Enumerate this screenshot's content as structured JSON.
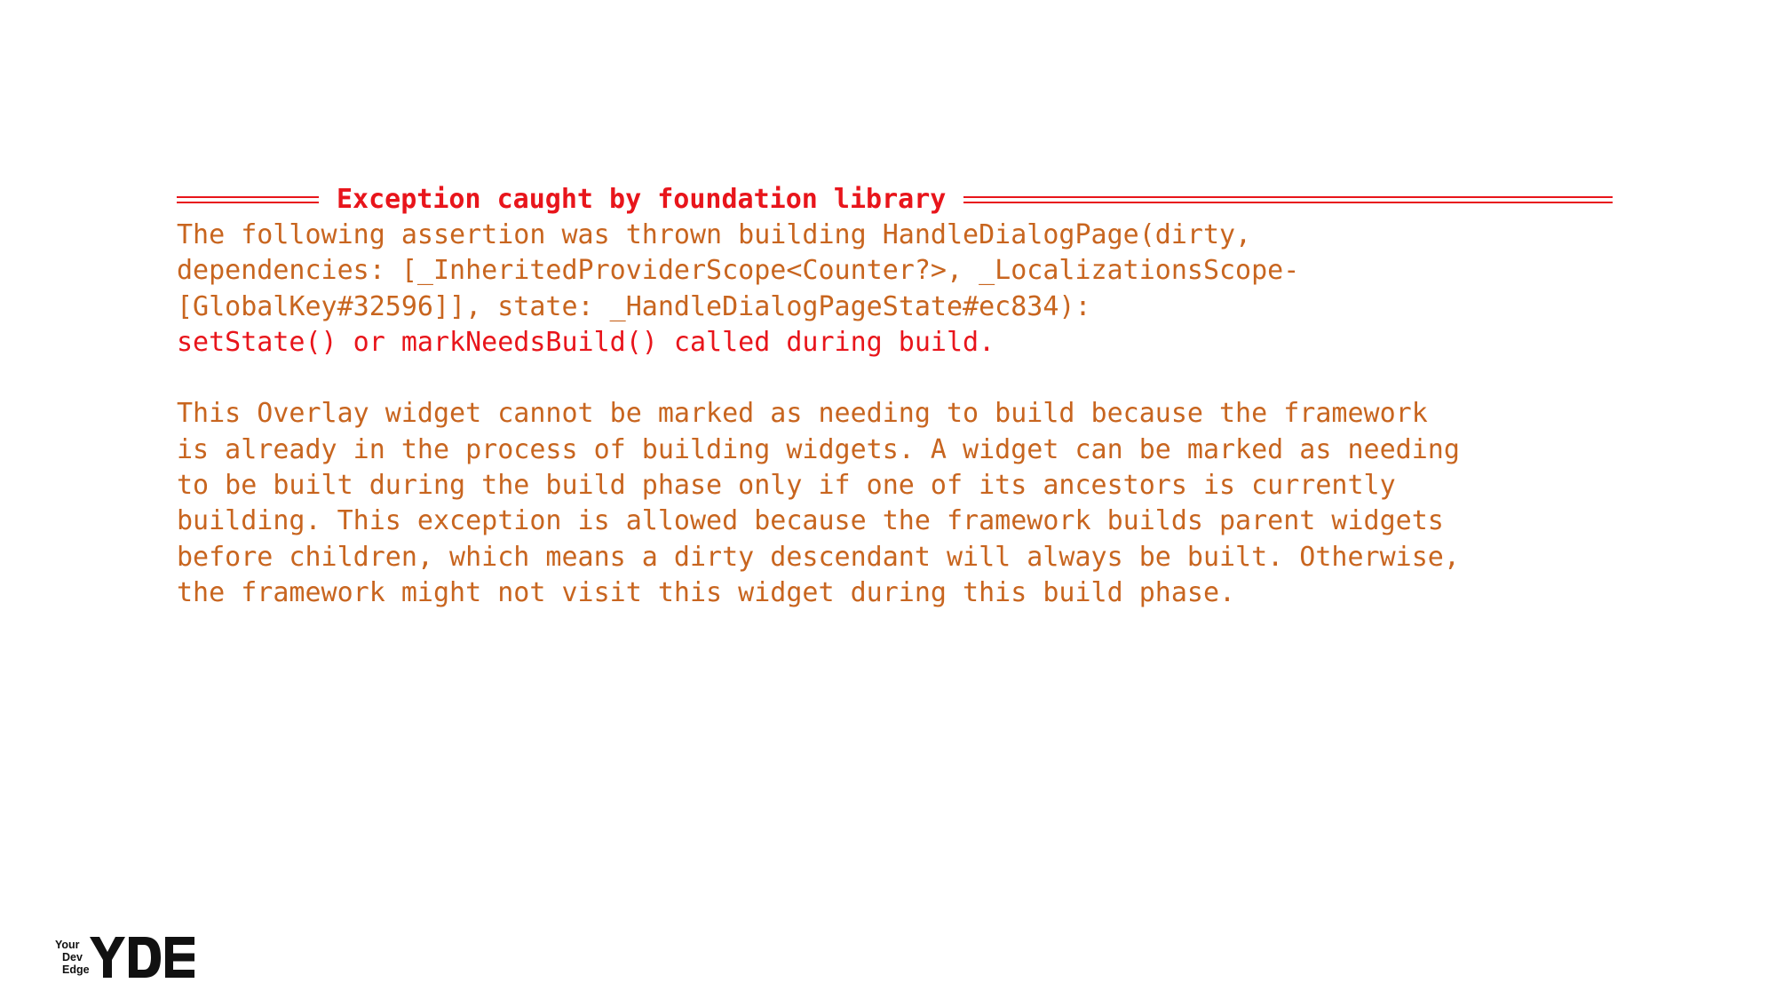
{
  "console": {
    "header": "Exception caught by foundation library",
    "lines": [
      "The following assertion was thrown building HandleDialogPage(dirty,",
      "dependencies: [_InheritedProviderScope<Counter?>, _LocalizationsScope-",
      "[GlobalKey#32596]], state: _HandleDialogPageState#ec834):"
    ],
    "error": "setState() or markNeedsBuild() called during build.",
    "explanation": [
      "This Overlay widget cannot be marked as needing to build because the framework",
      "is already in the process of building widgets. A widget can be marked as needing",
      "to be built during the build phase only if one of its ancestors is currently",
      "building. This exception is allowed because the framework builds parent widgets",
      "before children, which means a dirty descendant will always be built. Otherwise,",
      "the framework might not visit this widget during this build phase."
    ]
  },
  "logo": {
    "words": [
      "Your",
      "Dev",
      "Edge"
    ],
    "mark": "YDE"
  },
  "colors": {
    "error_red": "#e8151b",
    "text_orange": "#c8651f",
    "logo_dark": "#111111"
  }
}
